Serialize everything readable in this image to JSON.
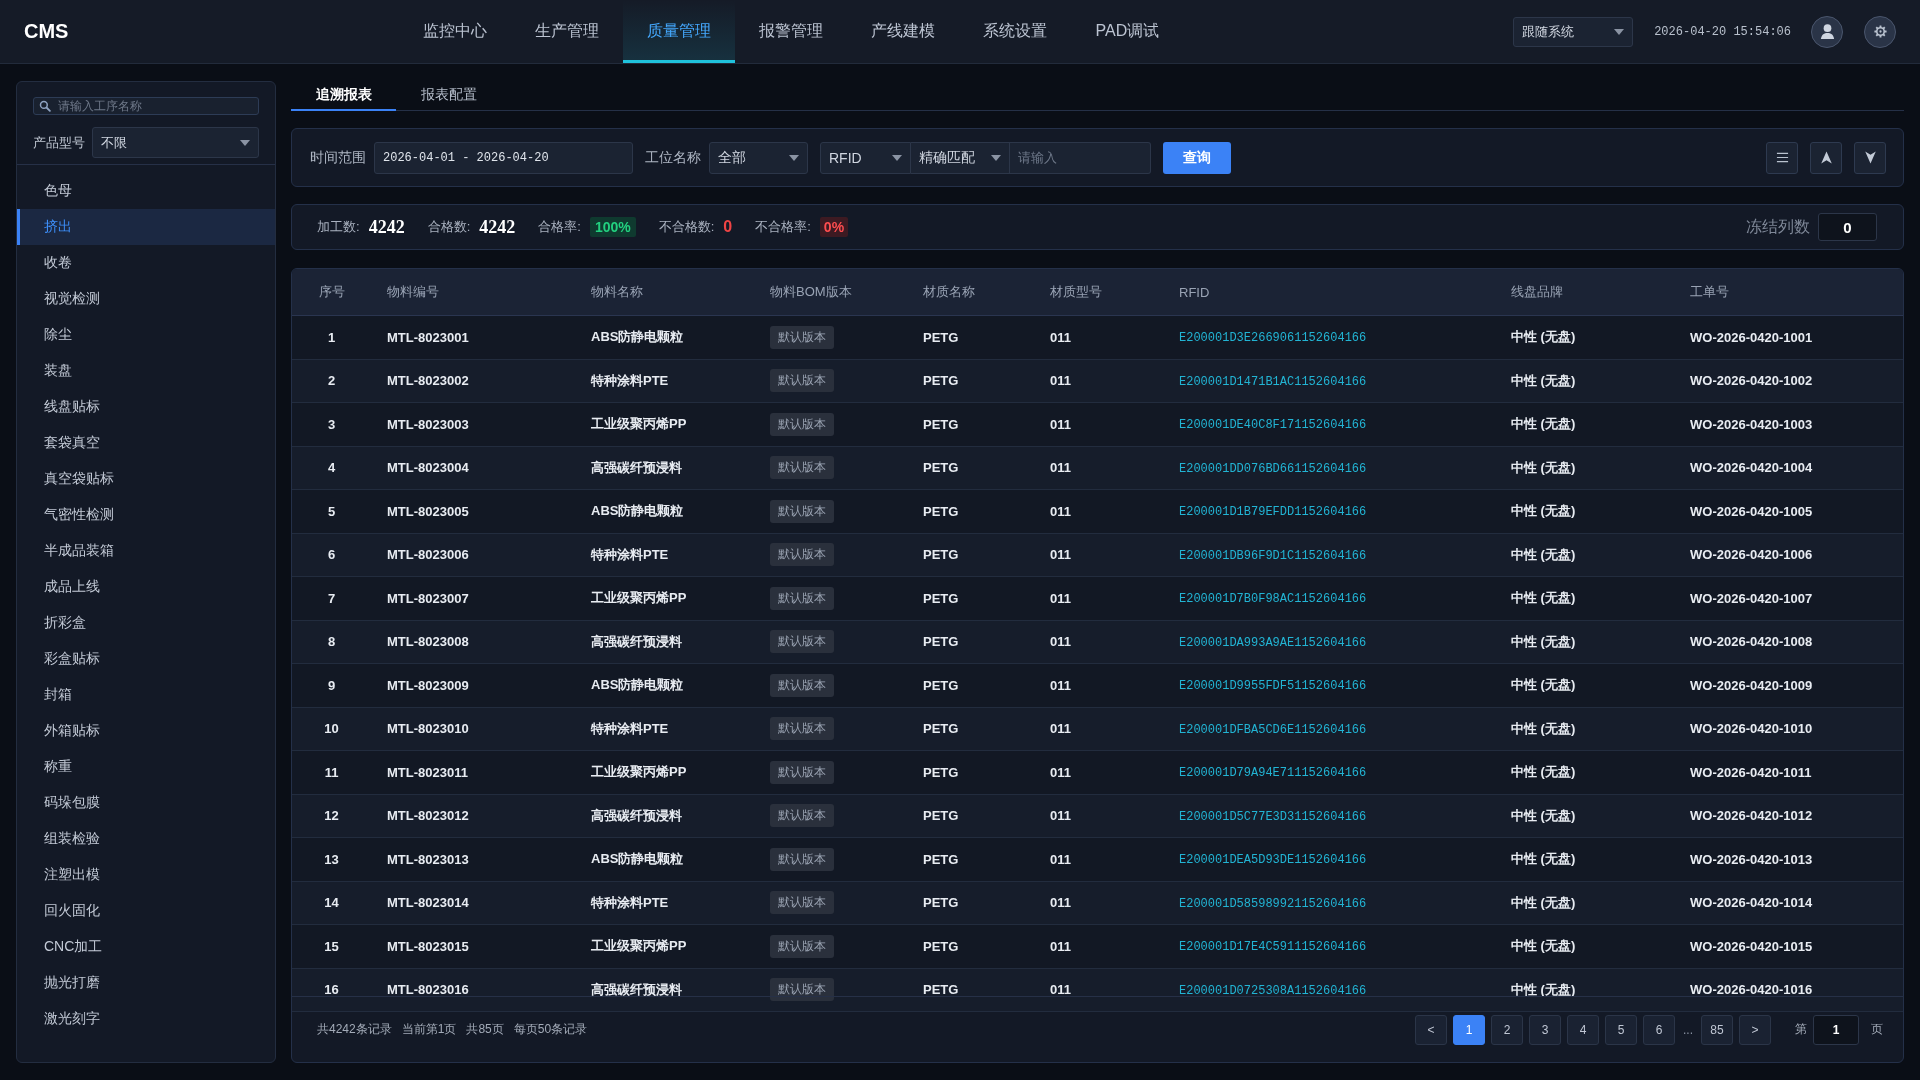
{
  "top_bar": {
    "logo": "CMS",
    "theme_select": {
      "value": "跟随系统"
    },
    "datetime": "2026-04-20 15:54:06"
  },
  "nav": [
    {
      "label": "监控中心",
      "selected": false
    },
    {
      "label": "生产管理",
      "selected": false
    },
    {
      "label": "质量管理",
      "selected": true
    },
    {
      "label": "报警管理",
      "selected": false
    },
    {
      "label": "产线建模",
      "selected": false
    },
    {
      "label": "系统设置",
      "selected": false
    },
    {
      "label": "PAD调试",
      "selected": false
    }
  ],
  "sidebar": {
    "search": {
      "placeholder": "请输入工序名称"
    },
    "product_model": {
      "label": "产品型号",
      "value": "不限"
    },
    "items": [
      {
        "label": "色母",
        "selected": false
      },
      {
        "label": "挤出",
        "selected": true
      },
      {
        "label": "收卷",
        "selected": false
      },
      {
        "label": "视觉检测",
        "selected": false
      },
      {
        "label": "除尘",
        "selected": false
      },
      {
        "label": "装盘",
        "selected": false
      },
      {
        "label": "线盘贴标",
        "selected": false
      },
      {
        "label": "套袋真空",
        "selected": false
      },
      {
        "label": "真空袋贴标",
        "selected": false
      },
      {
        "label": "气密性检测",
        "selected": false
      },
      {
        "label": "半成品装箱",
        "selected": false
      },
      {
        "label": "成品上线",
        "selected": false
      },
      {
        "label": "折彩盒",
        "selected": false
      },
      {
        "label": "彩盒贴标",
        "selected": false
      },
      {
        "label": "封箱",
        "selected": false
      },
      {
        "label": "外箱贴标",
        "selected": false
      },
      {
        "label": "称重",
        "selected": false
      },
      {
        "label": "码垛包膜",
        "selected": false
      },
      {
        "label": "组装检验",
        "selected": false
      },
      {
        "label": "注塑出模",
        "selected": false
      },
      {
        "label": "回火固化",
        "selected": false
      },
      {
        "label": "CNC加工",
        "selected": false
      },
      {
        "label": "抛光打磨",
        "selected": false
      },
      {
        "label": "激光刻字",
        "selected": false
      }
    ]
  },
  "tabs": [
    {
      "label": "追溯报表",
      "selected": true
    },
    {
      "label": "报表配置",
      "selected": false
    }
  ],
  "filters": {
    "time_range": {
      "label": "时间范围",
      "value": "2026-04-01 - 2026-04-20"
    },
    "station": {
      "label": "工位名称",
      "value": "全部"
    },
    "field_select": {
      "value": "RFID"
    },
    "match_select": {
      "value": "精确匹配"
    },
    "keyword": {
      "placeholder": "请输入"
    },
    "query_button": "查询"
  },
  "stats": [
    {
      "label": "加工数:",
      "value": "4242",
      "kind": "number"
    },
    {
      "label": "合格数:",
      "value": "4242",
      "kind": "number"
    },
    {
      "label": "合格率:",
      "value": "100%",
      "kind": "good_rate"
    },
    {
      "label": "不合格数:",
      "value": "0",
      "kind": "bad_number"
    },
    {
      "label": "不合格率:",
      "value": "0%",
      "kind": "bad_rate"
    }
  ],
  "freeze_columns": {
    "label": "冻结列数",
    "value": "0"
  },
  "table": {
    "columns": [
      {
        "label": "序号",
        "kind": "index"
      },
      {
        "label": "物料编号",
        "kind": "text"
      },
      {
        "label": "物料名称",
        "kind": "text"
      },
      {
        "label": "物料BOM版本",
        "kind": "tag"
      },
      {
        "label": "材质名称",
        "kind": "text"
      },
      {
        "label": "材质型号",
        "kind": "text"
      },
      {
        "label": "RFID",
        "kind": "code"
      },
      {
        "label": "线盘品牌",
        "kind": "text"
      },
      {
        "label": "工单号",
        "kind": "text"
      }
    ],
    "rows": [
      [
        "1",
        "MTL-8023001",
        "ABS防静电颗粒",
        "默认版本",
        "PETG",
        "011",
        "E200001D3E2669061152604166",
        "中性 (无盘)",
        "WO-2026-0420-1001"
      ],
      [
        "2",
        "MTL-8023002",
        "特种涂料PTE",
        "默认版本",
        "PETG",
        "011",
        "E200001D1471B1AC1152604166",
        "中性 (无盘)",
        "WO-2026-0420-1002"
      ],
      [
        "3",
        "MTL-8023003",
        "工业级聚丙烯PP",
        "默认版本",
        "PETG",
        "011",
        "E200001DE40C8F171152604166",
        "中性 (无盘)",
        "WO-2026-0420-1003"
      ],
      [
        "4",
        "MTL-8023004",
        "高强碳纤预浸料",
        "默认版本",
        "PETG",
        "011",
        "E200001DD076BD661152604166",
        "中性 (无盘)",
        "WO-2026-0420-1004"
      ],
      [
        "5",
        "MTL-8023005",
        "ABS防静电颗粒",
        "默认版本",
        "PETG",
        "011",
        "E200001D1B79EFDD1152604166",
        "中性 (无盘)",
        "WO-2026-0420-1005"
      ],
      [
        "6",
        "MTL-8023006",
        "特种涂料PTE",
        "默认版本",
        "PETG",
        "011",
        "E200001DB96F9D1C1152604166",
        "中性 (无盘)",
        "WO-2026-0420-1006"
      ],
      [
        "7",
        "MTL-8023007",
        "工业级聚丙烯PP",
        "默认版本",
        "PETG",
        "011",
        "E200001D7B0F98AC1152604166",
        "中性 (无盘)",
        "WO-2026-0420-1007"
      ],
      [
        "8",
        "MTL-8023008",
        "高强碳纤预浸料",
        "默认版本",
        "PETG",
        "011",
        "E200001DA993A9AE1152604166",
        "中性 (无盘)",
        "WO-2026-0420-1008"
      ],
      [
        "9",
        "MTL-8023009",
        "ABS防静电颗粒",
        "默认版本",
        "PETG",
        "011",
        "E200001D9955FDF51152604166",
        "中性 (无盘)",
        "WO-2026-0420-1009"
      ],
      [
        "10",
        "MTL-8023010",
        "特种涂料PTE",
        "默认版本",
        "PETG",
        "011",
        "E200001DFBA5CD6E1152604166",
        "中性 (无盘)",
        "WO-2026-0420-1010"
      ],
      [
        "11",
        "MTL-8023011",
        "工业级聚丙烯PP",
        "默认版本",
        "PETG",
        "011",
        "E200001D79A94E711152604166",
        "中性 (无盘)",
        "WO-2026-0420-1011"
      ],
      [
        "12",
        "MTL-8023012",
        "高强碳纤预浸料",
        "默认版本",
        "PETG",
        "011",
        "E200001D5C77E3D31152604166",
        "中性 (无盘)",
        "WO-2026-0420-1012"
      ],
      [
        "13",
        "MTL-8023013",
        "ABS防静电颗粒",
        "默认版本",
        "PETG",
        "011",
        "E200001DEA5D93DE1152604166",
        "中性 (无盘)",
        "WO-2026-0420-1013"
      ],
      [
        "14",
        "MTL-8023014",
        "特种涂料PTE",
        "默认版本",
        "PETG",
        "011",
        "E200001D585989921152604166",
        "中性 (无盘)",
        "WO-2026-0420-1014"
      ],
      [
        "15",
        "MTL-8023015",
        "工业级聚丙烯PP",
        "默认版本",
        "PETG",
        "011",
        "E200001D17E4C5911152604166",
        "中性 (无盘)",
        "WO-2026-0420-1015"
      ],
      [
        "16",
        "MTL-8023016",
        "高强碳纤预浸料",
        "默认版本",
        "PETG",
        "011",
        "E200001D0725308A1152604166",
        "中性 (无盘)",
        "WO-2026-0420-1016"
      ]
    ]
  },
  "pagination": {
    "summary": [
      "共4242条记录",
      "当前第1页",
      "共85页",
      "每页50条记录"
    ],
    "prev": "<",
    "pages": [
      {
        "kind": "page",
        "label": "1",
        "selected": true
      },
      {
        "kind": "page",
        "label": "2",
        "selected": false
      },
      {
        "kind": "page",
        "label": "3",
        "selected": false
      },
      {
        "kind": "page",
        "label": "4",
        "selected": false
      },
      {
        "kind": "page",
        "label": "5",
        "selected": false
      },
      {
        "kind": "page",
        "label": "6",
        "selected": false
      },
      {
        "kind": "ellipsis",
        "label": "..."
      },
      {
        "kind": "page",
        "label": "85",
        "selected": false
      }
    ],
    "next": ">",
    "jump": {
      "prefix": "第",
      "value": "1",
      "suffix": "页"
    }
  }
}
